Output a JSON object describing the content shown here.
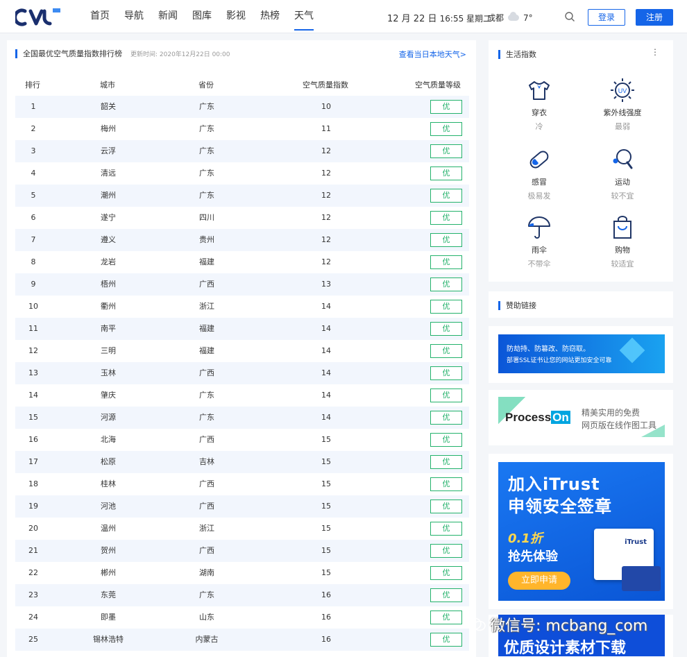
{
  "header": {
    "nav": [
      "首页",
      "导航",
      "新闻",
      "图库",
      "影视",
      "热榜",
      "天气"
    ],
    "active_nav": "天气",
    "date": "12 月 22 日",
    "time": "16:55 星期二",
    "city": "成都",
    "temp": "7°",
    "login_label": "登录",
    "register_label": "注册",
    "accent_color": "#1565e8"
  },
  "ranking": {
    "title": "全国最优空气质量指数排行榜",
    "update": "更新时间: 2020年12月22日 00:00",
    "link": "查看当日本地天气>",
    "columns": [
      "排行",
      "城市",
      "省份",
      "空气质量指数",
      "空气质量等级"
    ],
    "rows": [
      {
        "rank": "1",
        "city": "韶关",
        "province": "广东",
        "aqi": "10",
        "level": "优"
      },
      {
        "rank": "2",
        "city": "梅州",
        "province": "广东",
        "aqi": "11",
        "level": "优"
      },
      {
        "rank": "3",
        "city": "云浮",
        "province": "广东",
        "aqi": "12",
        "level": "优"
      },
      {
        "rank": "4",
        "city": "清远",
        "province": "广东",
        "aqi": "12",
        "level": "优"
      },
      {
        "rank": "5",
        "city": "潮州",
        "province": "广东",
        "aqi": "12",
        "level": "优"
      },
      {
        "rank": "6",
        "city": "遂宁",
        "province": "四川",
        "aqi": "12",
        "level": "优"
      },
      {
        "rank": "7",
        "city": "遵义",
        "province": "贵州",
        "aqi": "12",
        "level": "优"
      },
      {
        "rank": "8",
        "city": "龙岩",
        "province": "福建",
        "aqi": "12",
        "level": "优"
      },
      {
        "rank": "9",
        "city": "梧州",
        "province": "广西",
        "aqi": "13",
        "level": "优"
      },
      {
        "rank": "10",
        "city": "衢州",
        "province": "浙江",
        "aqi": "14",
        "level": "优"
      },
      {
        "rank": "11",
        "city": "南平",
        "province": "福建",
        "aqi": "14",
        "level": "优"
      },
      {
        "rank": "12",
        "city": "三明",
        "province": "福建",
        "aqi": "14",
        "level": "优"
      },
      {
        "rank": "13",
        "city": "玉林",
        "province": "广西",
        "aqi": "14",
        "level": "优"
      },
      {
        "rank": "14",
        "city": "肇庆",
        "province": "广东",
        "aqi": "14",
        "level": "优"
      },
      {
        "rank": "15",
        "city": "河源",
        "province": "广东",
        "aqi": "14",
        "level": "优"
      },
      {
        "rank": "16",
        "city": "北海",
        "province": "广西",
        "aqi": "15",
        "level": "优"
      },
      {
        "rank": "17",
        "city": "松原",
        "province": "吉林",
        "aqi": "15",
        "level": "优"
      },
      {
        "rank": "18",
        "city": "桂林",
        "province": "广西",
        "aqi": "15",
        "level": "优"
      },
      {
        "rank": "19",
        "city": "河池",
        "province": "广西",
        "aqi": "15",
        "level": "优"
      },
      {
        "rank": "20",
        "city": "温州",
        "province": "浙江",
        "aqi": "15",
        "level": "优"
      },
      {
        "rank": "21",
        "city": "贺州",
        "province": "广西",
        "aqi": "15",
        "level": "优"
      },
      {
        "rank": "22",
        "city": "郴州",
        "province": "湖南",
        "aqi": "15",
        "level": "优"
      },
      {
        "rank": "23",
        "city": "东莞",
        "province": "广东",
        "aqi": "16",
        "level": "优"
      },
      {
        "rank": "24",
        "city": "即墨",
        "province": "山东",
        "aqi": "16",
        "level": "优"
      },
      {
        "rank": "25",
        "city": "锡林浩特",
        "province": "内蒙古",
        "aqi": "16",
        "level": "优"
      }
    ],
    "level_color": "#23b26b"
  },
  "life": {
    "title": "生活指数",
    "items": [
      {
        "icon": "shirt-icon",
        "name": "穿衣",
        "value": "冷"
      },
      {
        "icon": "uv-icon",
        "name": "紫外线强度",
        "value": "最弱"
      },
      {
        "icon": "pill-icon",
        "name": "感冒",
        "value": "极易发"
      },
      {
        "icon": "pingpong-icon",
        "name": "运动",
        "value": "较不宜"
      },
      {
        "icon": "umbrella-icon",
        "name": "雨伞",
        "value": "不带伞"
      },
      {
        "icon": "shopping-bag-icon",
        "name": "购物",
        "value": "较适宜"
      }
    ]
  },
  "sponsor": {
    "title": "赞助链接",
    "ad1_line1": "防劫持、防篡改、防窃取。",
    "ad1_line2": "部署SSL证书让您的网站更加安全可靠",
    "ad2_logo_a": "Process",
    "ad2_logo_b": "On",
    "ad2_line1": "精美实用的免费",
    "ad2_line2": "网页版在线作图工具",
    "ad3_h1": "加入iTrust",
    "ad3_h2": "申领安全签章",
    "ad3_promo": "0.1折",
    "ad3_promo2": "抢先体验",
    "ad3_btn": "立即申请",
    "ad3_brand": "iTrust",
    "ad4_text": "优质设计素材下载"
  },
  "watermark": "微信号: mcbang_com"
}
